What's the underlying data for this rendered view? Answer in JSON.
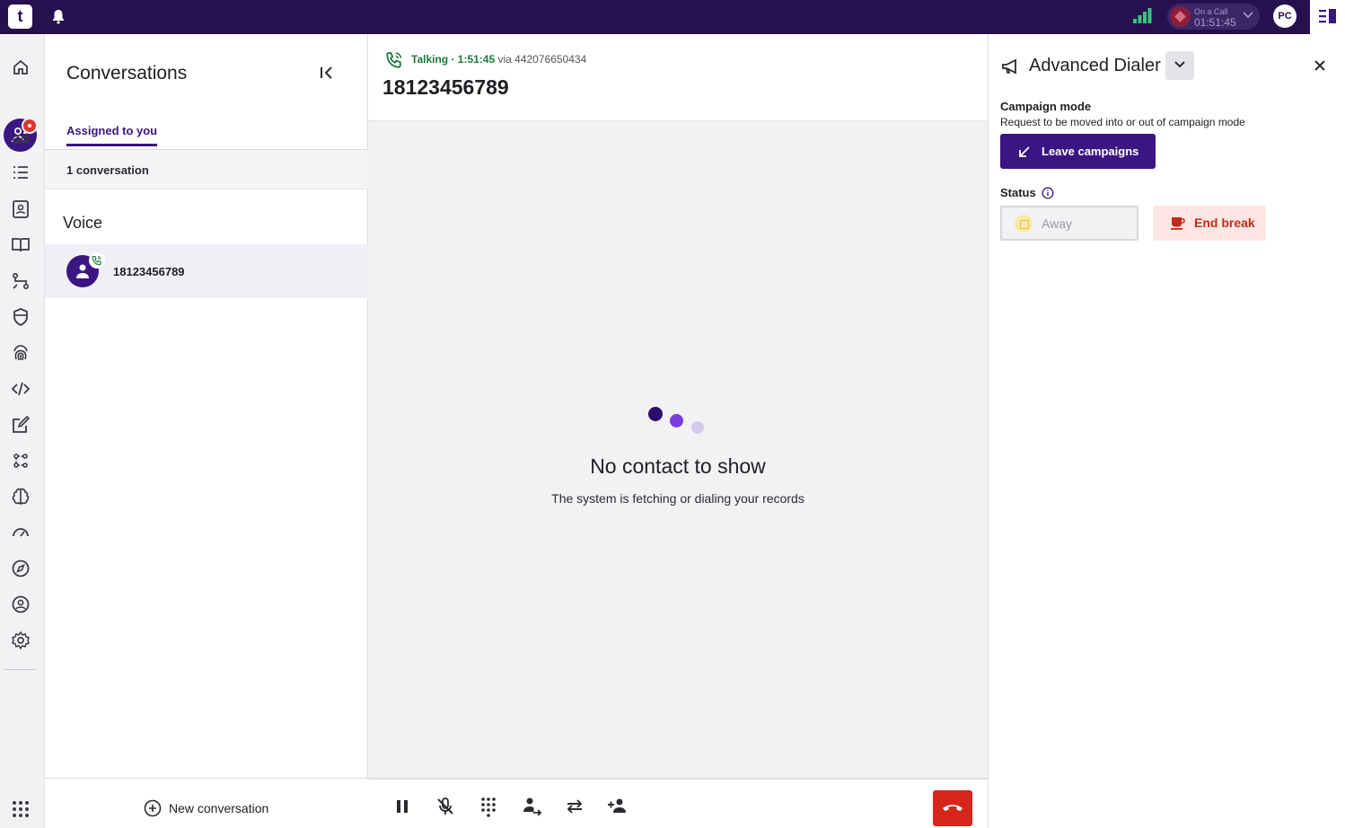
{
  "topbar": {
    "logo": "t",
    "oncall_label": "On a Call",
    "oncall_time": "01:51:45",
    "user_initials": "PC",
    "icons": [
      "bell-icon",
      "signal-strength-icon",
      "chevron-down-icon",
      "panel-toggle-icon"
    ]
  },
  "leftnav": {
    "items": [
      "home-icon",
      "conversations-icon",
      "voicemail-icon",
      "list-icon",
      "contacts-icon",
      "book-icon",
      "workflow-icon",
      "shield-icon",
      "fingerprint-icon",
      "code-icon",
      "edit-icon",
      "analytics-icon",
      "brain-icon",
      "speedometer-icon",
      "compass-icon",
      "user-circle-icon",
      "settings-icon",
      "apps-grid-icon"
    ]
  },
  "conversations": {
    "title": "Conversations",
    "tab_assigned": "Assigned to you",
    "count": "1 conversation",
    "section_voice": "Voice",
    "items": [
      {
        "number": "18123456789"
      }
    ],
    "new_conversation": "New conversation"
  },
  "call": {
    "status": "Talking · 1:51:45",
    "via": "via 442076650434",
    "number": "18123456789",
    "empty_title": "No contact to show",
    "empty_subtitle": "The system is fetching or dialing your records",
    "controls": [
      "pause-icon",
      "mute-icon",
      "dialpad-icon",
      "transfer-icon",
      "swap-icon",
      "add-participant-icon",
      "hangup-icon"
    ]
  },
  "dialer": {
    "title": "Advanced Dialer",
    "campaign_title": "Campaign mode",
    "campaign_sub": "Request to be moved into or out of campaign mode",
    "leave_btn": "Leave campaigns",
    "status_label": "Status",
    "status_value": "Away",
    "end_break_btn": "End break"
  },
  "colors": {
    "brand": "#27104e",
    "accent": "#3a1682",
    "talking": "#1b7a3c",
    "hangup": "#d6261c",
    "end_break_bg": "#fde6e4"
  }
}
